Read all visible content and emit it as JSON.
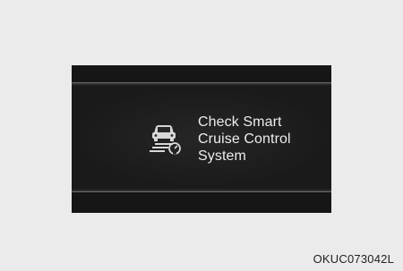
{
  "message": {
    "lines": [
      "Check Smart",
      "Cruise Control",
      "System"
    ]
  },
  "icon": "smart-cruise-control-icon",
  "figure_code": "OKUC073042L",
  "colors": {
    "page_background": "#ebebeb",
    "display_background": "#1a1a1a",
    "text": "#ededed",
    "icon": "#d8d8d8"
  }
}
